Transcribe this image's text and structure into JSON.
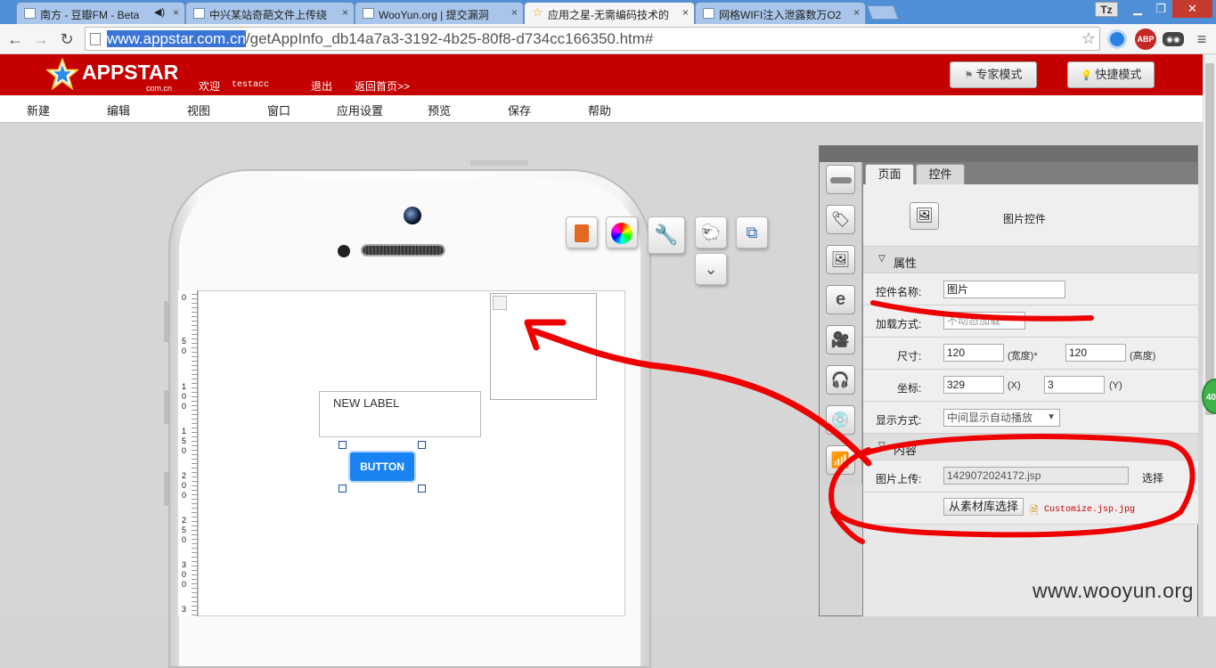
{
  "browser": {
    "tabs": [
      {
        "title": "南方 - 豆瓣FM - Beta",
        "icon": "douban-icon"
      },
      {
        "title": "中兴某站奇葩文件上传绕",
        "icon": "wooyun-icon"
      },
      {
        "title": "WooYun.org | 提交漏洞",
        "icon": "wooyun-icon"
      },
      {
        "title": "应用之星-无需编码技术的",
        "icon": "star-icon"
      },
      {
        "title": "网格WIFI注入泄露数万O2",
        "icon": "wooyun-icon"
      }
    ],
    "active_tab": 3,
    "user_badge": "Tz",
    "url_host": "www.appstar.com.cn",
    "url_path": "/getAppInfo_db14a7a3-3192-4b25-80f8-d734cc166350.htm#",
    "ext_abp": "ABP"
  },
  "app": {
    "logo_name": "APPSTAR",
    "logo_sub": "com.cn",
    "welcome": "欢迎",
    "username": "testacc",
    "logout": "退出",
    "home": "返回首页>>",
    "expert_mode": "专家模式",
    "quick_mode": "快捷模式",
    "menu": [
      "新建",
      "编辑",
      "视图",
      "窗口",
      "应用设置",
      "预览",
      "保存",
      "帮助"
    ]
  },
  "canvas": {
    "ruler_digits": [
      "0",
      "5",
      "0",
      "1",
      "0",
      "0",
      "1",
      "5",
      "0",
      "2",
      "0",
      "0",
      "2",
      "5",
      "0",
      "3",
      "0",
      "0",
      "3"
    ],
    "label_text": "NEW LABEL",
    "button_text": "BUTTON"
  },
  "panel": {
    "tab_page": "页面",
    "tab_control": "控件",
    "control_type": "图片控件",
    "section_props": "属性",
    "name_label": "控件名称:",
    "name_value": "图片",
    "load_label": "加载方式:",
    "load_value": "不动态加载",
    "size_label": "尺寸:",
    "width": "120",
    "width_unit": "(宽度)*",
    "height": "120",
    "height_unit": "(高度)",
    "pos_label": "坐标:",
    "x": "329",
    "x_unit": "(X)",
    "y": "3",
    "y_unit": "(Y)",
    "display_label": "显示方式:",
    "display_value": "中间显示自动播放",
    "section_content": "内容",
    "upload_label": "图片上传:",
    "upload_value": "1429072024172.jsp",
    "choose": "选择",
    "library_button": "从素材库选择",
    "file_name": "Customize.jsp.jpg"
  },
  "watermark": "www.wooyun.org",
  "side_badge": "40"
}
